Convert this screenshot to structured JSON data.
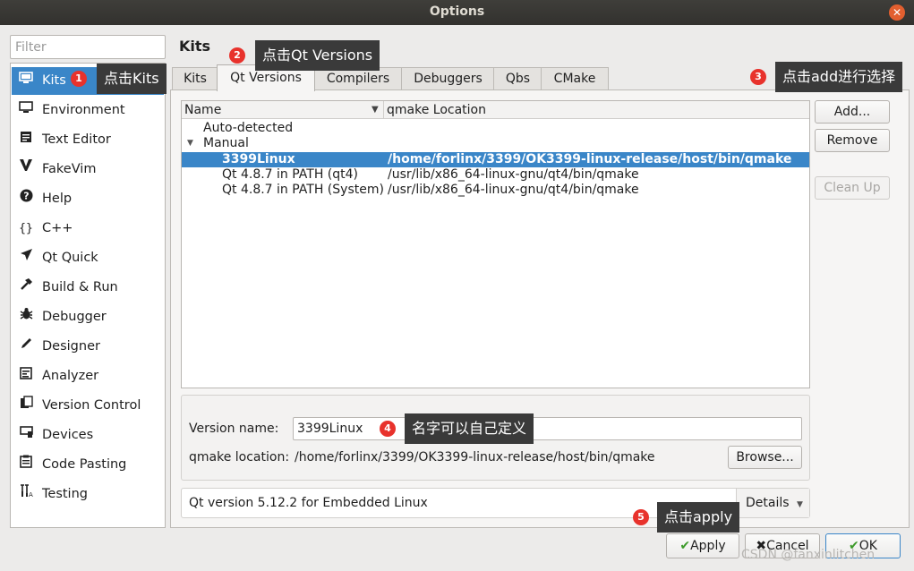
{
  "window": {
    "title": "Options",
    "close_glyph": "✕"
  },
  "filter": {
    "placeholder": "Filter"
  },
  "sidebar": {
    "items": [
      {
        "label": "Kits",
        "icon": "monitor-kit-icon"
      },
      {
        "label": "Environment",
        "icon": "monitor-icon"
      },
      {
        "label": "Text Editor",
        "icon": "text-editor-icon"
      },
      {
        "label": "FakeVim",
        "icon": "fakevim-icon"
      },
      {
        "label": "Help",
        "icon": "help-icon"
      },
      {
        "label": "C++",
        "icon": "braces-icon"
      },
      {
        "label": "Qt Quick",
        "icon": "qt-quick-icon"
      },
      {
        "label": "Build & Run",
        "icon": "hammer-icon"
      },
      {
        "label": "Debugger",
        "icon": "bug-icon"
      },
      {
        "label": "Designer",
        "icon": "pen-icon"
      },
      {
        "label": "Analyzer",
        "icon": "analyzer-icon"
      },
      {
        "label": "Version Control",
        "icon": "version-control-icon"
      },
      {
        "label": "Devices",
        "icon": "devices-icon"
      },
      {
        "label": "Code Pasting",
        "icon": "code-pasting-icon"
      },
      {
        "label": "Testing",
        "icon": "testing-icon"
      }
    ],
    "selected": "Kits"
  },
  "main": {
    "heading": "Kits",
    "tabs": [
      "Kits",
      "Qt Versions",
      "Compilers",
      "Debuggers",
      "Qbs",
      "CMake"
    ],
    "active_tab": "Qt Versions",
    "tree": {
      "columns": [
        "Name",
        "qmake Location"
      ],
      "groups": [
        {
          "label": "Auto-detected",
          "rows": []
        },
        {
          "label": "Manual",
          "expanded": true,
          "rows": [
            {
              "name": "3399Linux",
              "location": "/home/forlinx/3399/OK3399-linux-release/host/bin/qmake",
              "selected": true
            },
            {
              "name": "Qt 4.8.7 in PATH (qt4)",
              "location": "/usr/lib/x86_64-linux-gnu/qt4/bin/qmake"
            },
            {
              "name": "Qt 4.8.7 in PATH (System)",
              "location": "/usr/lib/x86_64-linux-gnu/qt4/bin/qmake"
            }
          ]
        }
      ]
    },
    "buttons": {
      "add": "Add...",
      "remove": "Remove",
      "clean_up": "Clean Up"
    },
    "details": {
      "version_name_label": "Version name:",
      "version_name_value": "3399Linux",
      "qmake_location_label": "qmake location:",
      "qmake_location_value": "/home/forlinx/3399/OK3399-linux-release/host/bin/qmake",
      "browse": "Browse...",
      "status": "Qt version 5.12.2 for Embedded Linux",
      "details_button": "Details"
    }
  },
  "footer": {
    "apply": "Apply",
    "cancel": "Cancel",
    "ok": "OK"
  },
  "annotations": [
    {
      "n": "1",
      "text": "点击Kits"
    },
    {
      "n": "2",
      "text": "点击Qt Versions"
    },
    {
      "n": "3",
      "text": "点击add进行选择"
    },
    {
      "n": "4",
      "text": "名字可以自己定义"
    },
    {
      "n": "5",
      "text": "点击apply"
    }
  ],
  "watermark": "CSDN @fanxinlitchen",
  "colors": {
    "selection": "#3a86c8",
    "annotation_badge": "#e8322c",
    "annotation_tip": "#3a3a3a",
    "titlebar": "#3a3935"
  }
}
